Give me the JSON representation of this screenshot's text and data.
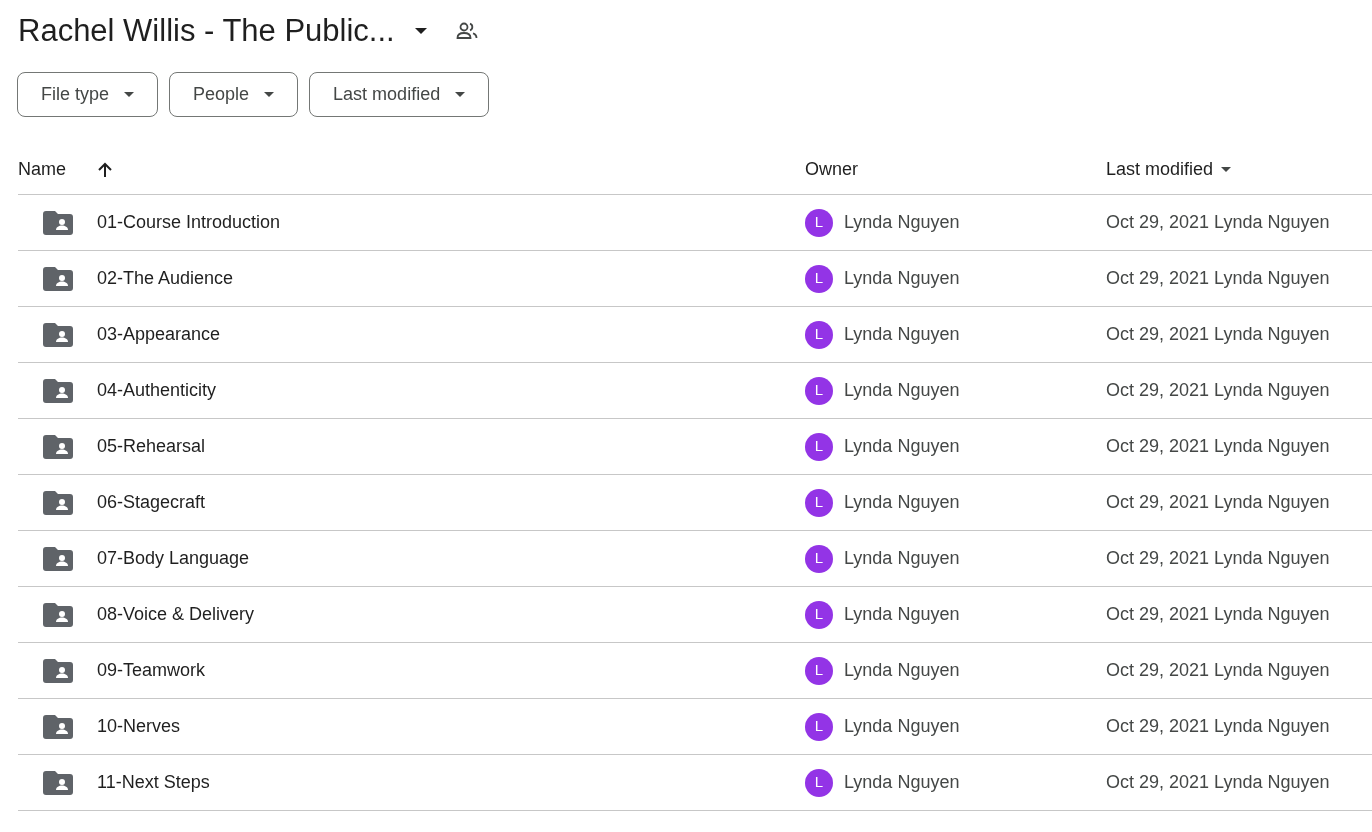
{
  "header": {
    "title": "Rachel Willis - The Public..."
  },
  "filters": [
    {
      "label": "File type"
    },
    {
      "label": "People"
    },
    {
      "label": "Last modified"
    }
  ],
  "columns": [
    {
      "label": "Name",
      "kind": "sorted"
    },
    {
      "label": "Owner",
      "kind": "plain"
    },
    {
      "label": "Last modified",
      "kind": "menu"
    }
  ],
  "rows": [
    {
      "name": "01-Course Introduction",
      "owner": "Lynda Nguyen",
      "avatar": "L",
      "color": "#9334e6",
      "modified": "Oct 29, 2021 Lynda Nguyen"
    },
    {
      "name": "02-The Audience",
      "owner": "Lynda Nguyen",
      "avatar": "L",
      "color": "#9334e6",
      "modified": "Oct 29, 2021 Lynda Nguyen"
    },
    {
      "name": "03-Appearance",
      "owner": "Lynda Nguyen",
      "avatar": "L",
      "color": "#9334e6",
      "modified": "Oct 29, 2021 Lynda Nguyen"
    },
    {
      "name": "04-Authenticity",
      "owner": "Lynda Nguyen",
      "avatar": "L",
      "color": "#9334e6",
      "modified": "Oct 29, 2021 Lynda Nguyen"
    },
    {
      "name": "05-Rehearsal",
      "owner": "Lynda Nguyen",
      "avatar": "L",
      "color": "#9334e6",
      "modified": "Oct 29, 2021 Lynda Nguyen"
    },
    {
      "name": "06-Stagecraft",
      "owner": "Lynda Nguyen",
      "avatar": "L",
      "color": "#9334e6",
      "modified": "Oct 29, 2021 Lynda Nguyen"
    },
    {
      "name": "07-Body Language",
      "owner": "Lynda Nguyen",
      "avatar": "L",
      "color": "#9334e6",
      "modified": "Oct 29, 2021 Lynda Nguyen"
    },
    {
      "name": "08-Voice & Delivery",
      "owner": "Lynda Nguyen",
      "avatar": "L",
      "color": "#9334e6",
      "modified": "Oct 29, 2021 Lynda Nguyen"
    },
    {
      "name": "09-Teamwork",
      "owner": "Lynda Nguyen",
      "avatar": "L",
      "color": "#9334e6",
      "modified": "Oct 29, 2021 Lynda Nguyen"
    },
    {
      "name": "10-Nerves",
      "owner": "Lynda Nguyen",
      "avatar": "L",
      "color": "#9334e6",
      "modified": "Oct 29, 2021 Lynda Nguyen"
    },
    {
      "name": "11-Next Steps",
      "owner": "Lynda Nguyen",
      "avatar": "L",
      "color": "#9334e6",
      "modified": "Oct 29, 2021 Lynda Nguyen"
    }
  ]
}
